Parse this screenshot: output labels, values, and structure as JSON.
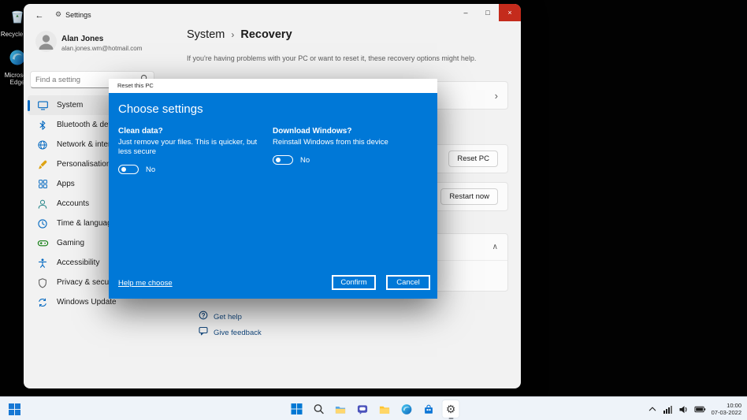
{
  "colors": {
    "accent": "#0067c0",
    "dialog_blue": "#0078d7",
    "close_button_red": "#c42b1c",
    "taskbar_bg": "#eef3f9"
  },
  "icons": {
    "back": "←",
    "minimize": "–",
    "maximize": "□",
    "close": "×",
    "chevron_right": "›",
    "chevron_up": "∧",
    "gear": "⚙"
  },
  "desktop": {
    "icons": [
      {
        "label": "Recycle Bin"
      },
      {
        "label": "Microsoft Edge"
      }
    ]
  },
  "window": {
    "titlebar": {
      "title": "Settings"
    },
    "user": {
      "name": "Alan Jones",
      "email": "alan.jones.wm@hotmail.com"
    },
    "search": {
      "placeholder": "Find a setting"
    },
    "sidebar": [
      {
        "label": "System"
      },
      {
        "label": "Bluetooth & devices"
      },
      {
        "label": "Network & internet"
      },
      {
        "label": "Personalisation"
      },
      {
        "label": "Apps"
      },
      {
        "label": "Accounts"
      },
      {
        "label": "Time & language"
      },
      {
        "label": "Gaming"
      },
      {
        "label": "Accessibility"
      },
      {
        "label": "Privacy & security"
      },
      {
        "label": "Windows Update"
      }
    ],
    "page": {
      "breadcrumb_root": "System",
      "breadcrumb_separator": "›",
      "title": "Recovery",
      "subtitle": "If you're having problems with your PC or want to reset it, these recovery options might help."
    },
    "content": {
      "reset_pc_button": "Reset PC",
      "restart_now_button": "Restart now"
    },
    "footer": {
      "get_help": "Get help",
      "give_feedback": "Give feedback"
    }
  },
  "dialog": {
    "title": "Reset this PC",
    "heading": "Choose settings",
    "options": [
      {
        "title": "Clean data?",
        "description": "Just remove your files. This is quicker, but less secure",
        "toggle_label": "No",
        "toggle_state": "off"
      },
      {
        "title": "Download Windows?",
        "description": "Reinstall Windows from this device",
        "toggle_label": "No",
        "toggle_state": "off"
      }
    ],
    "help_link": "Help me choose",
    "confirm_button": "Confirm",
    "cancel_button": "Cancel"
  },
  "taskbar": {
    "time": "10:00",
    "date": "07-03-2022"
  }
}
